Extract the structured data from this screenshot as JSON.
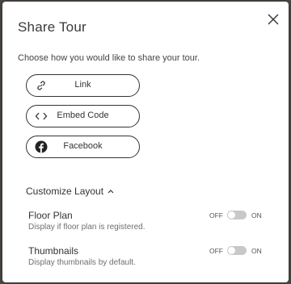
{
  "dialog": {
    "title": "Share Tour",
    "subtitle": "Choose how you would like to share your tour."
  },
  "options": [
    {
      "label": "Link",
      "icon": "link-icon"
    },
    {
      "label": "Embed Code",
      "icon": "code-icon"
    },
    {
      "label": "Facebook",
      "icon": "facebook-icon"
    }
  ],
  "customize": {
    "label": "Customize Layout",
    "expanded": true,
    "settings": [
      {
        "title": "Floor Plan",
        "description": "Display if floor plan is registered.",
        "off_label": "OFF",
        "on_label": "ON",
        "enabled": false
      },
      {
        "title": "Thumbnails",
        "description": "Display thumbnails by default.",
        "off_label": "OFF",
        "on_label": "ON",
        "enabled": false
      }
    ]
  }
}
